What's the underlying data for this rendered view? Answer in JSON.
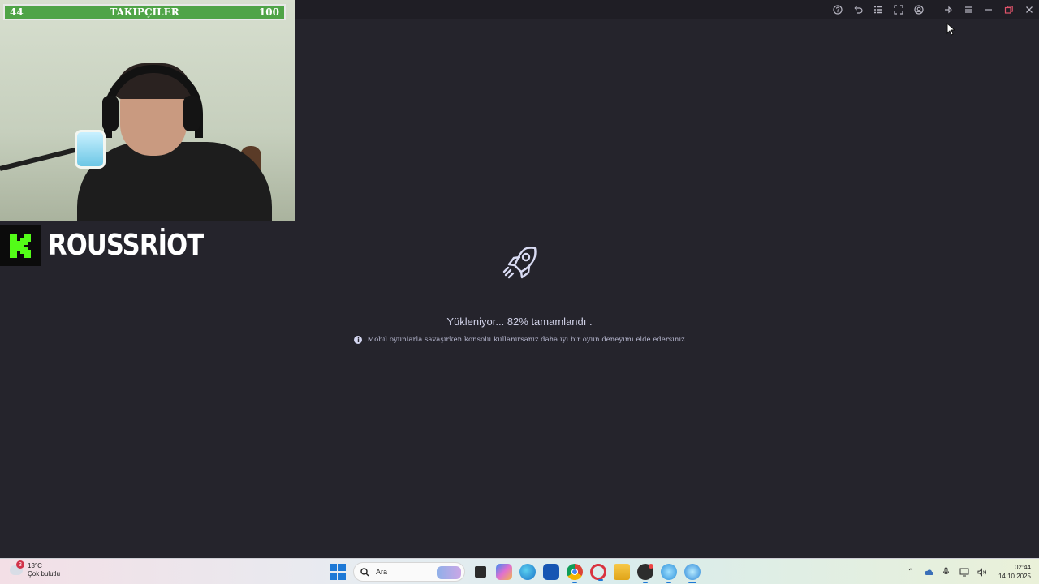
{
  "window": {
    "toolbar_icons": [
      "help-icon",
      "undo-icon",
      "list-icon",
      "fullscreen-icon",
      "profile-icon",
      "pin-icon",
      "menu-icon",
      "minimize-icon",
      "restore-icon",
      "close-icon"
    ]
  },
  "overlay": {
    "follower_goal": {
      "current": "44",
      "title": "TAKIPÇILER",
      "target": "100",
      "progress": 0.44
    },
    "streamer": {
      "platform_icon": "kick-logo",
      "name": "ROUSSRİOT"
    }
  },
  "loader": {
    "icon": "rocket-icon",
    "status": "Yükleniyor... 82% tamamlandı .",
    "progress_percent": 82,
    "tip": "Mobil oyunlarla savaşırken konsolu kullanırsanız daha iyi bir oyun deneyimi elde edersiniz"
  },
  "taskbar": {
    "weather": {
      "temp": "13°C",
      "condition": "Çok bulutlu",
      "badge": "3"
    },
    "search_placeholder": "Ara",
    "apps": [
      "file-explorer-icon",
      "copilot-icon",
      "edge-icon",
      "store-icon",
      "chrome-icon",
      "opera-icon",
      "folder-icon",
      "app-icon",
      "browser-icon",
      "active-app-icon"
    ],
    "tray_icons": [
      "chevron-up-icon",
      "onedrive-icon",
      "microphone-icon",
      "display-icon",
      "volume-icon"
    ],
    "time": "02:44",
    "date": "14.10.2025"
  },
  "colors": {
    "background": "#25242c",
    "goal_bar": "#4fa447",
    "kick_green": "#53fc18",
    "windows_blue": "#1d78d6"
  }
}
